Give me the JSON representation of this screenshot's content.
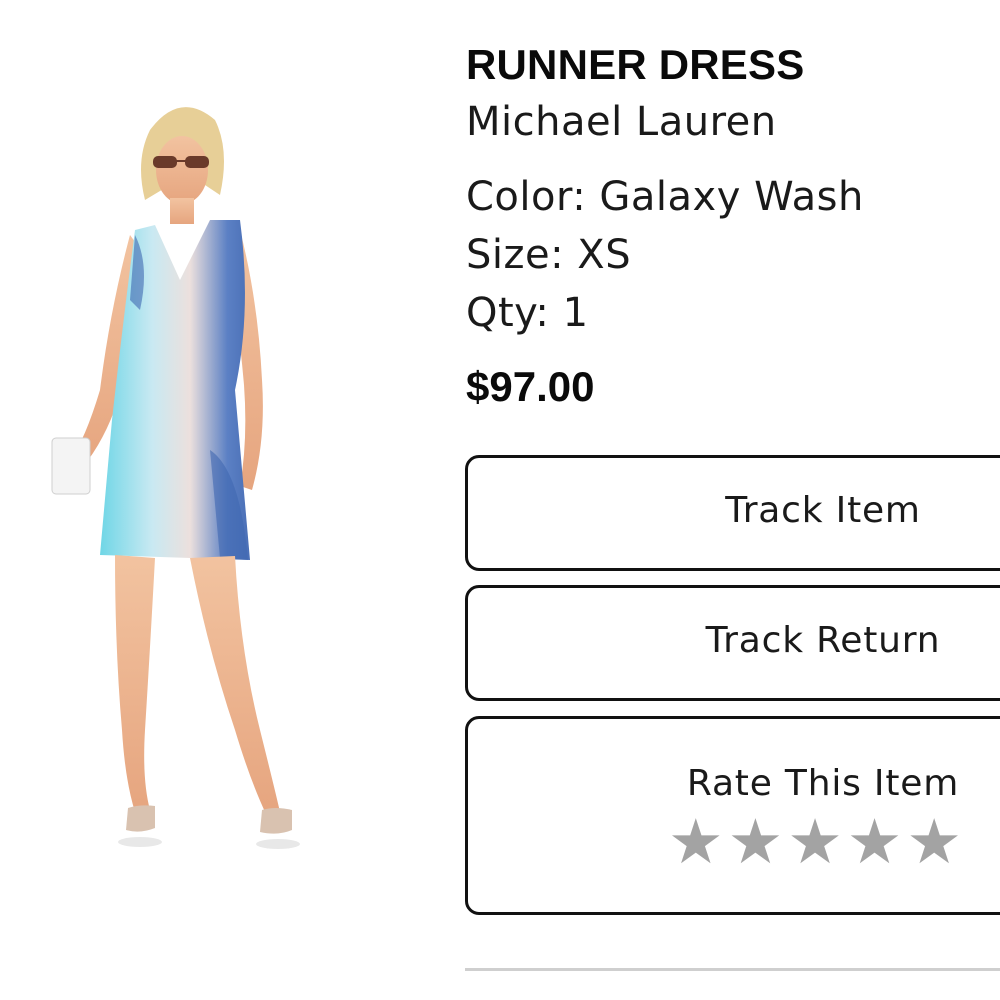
{
  "product": {
    "name": "RUNNER DRESS",
    "brand": "Michael Lauren",
    "color_line": "Color: Galaxy Wash",
    "size_line": "Size: XS",
    "qty_line": "Qty: 1",
    "price": "$97.00"
  },
  "actions": {
    "track_item": "Track Item",
    "track_return": "Track Return",
    "rate_item": "Rate This Item"
  },
  "rating": {
    "stars_total": 5,
    "stars_filled": 0,
    "star_color": "#a3a3a3"
  },
  "icons": {
    "star": "star-icon"
  }
}
